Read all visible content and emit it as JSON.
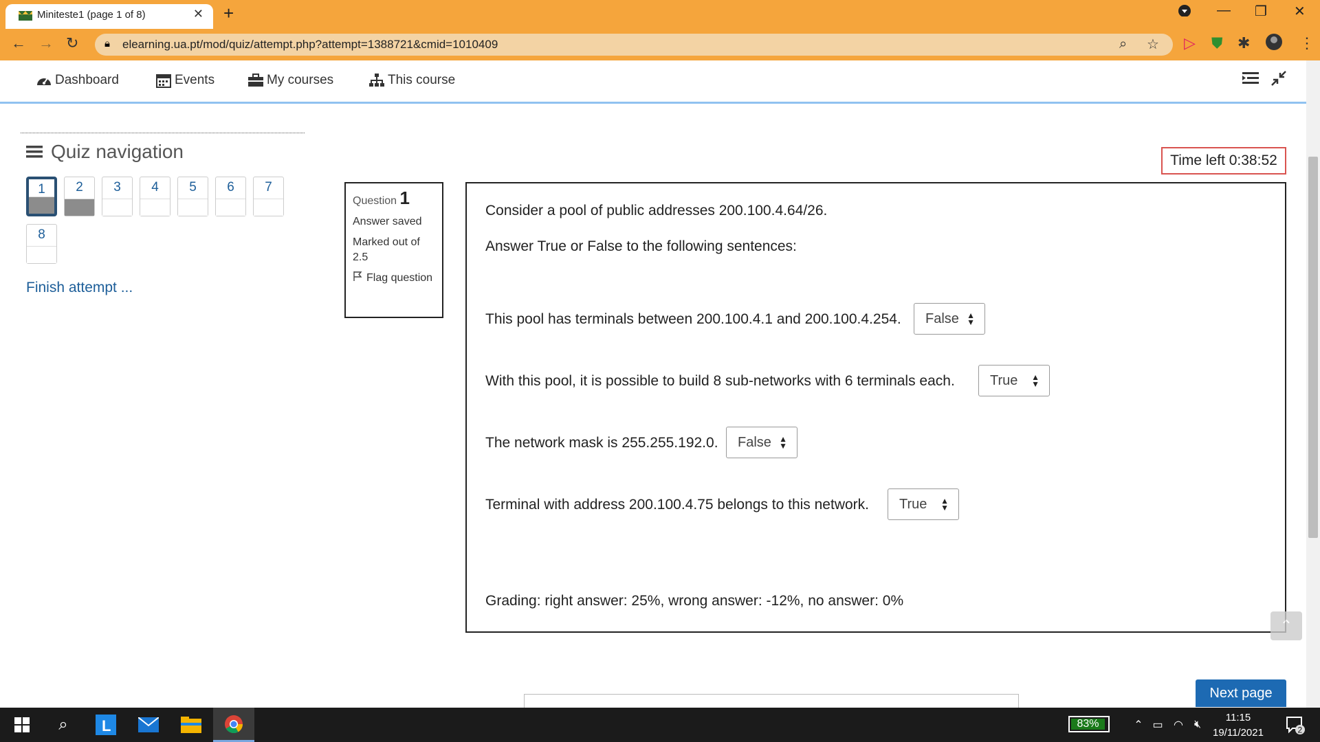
{
  "browser": {
    "tab_title": "Miniteste1 (page 1 of 8)",
    "url": "elearning.ua.pt/mod/quiz/attempt.php?attempt=1388721&cmid=1010409"
  },
  "topnav": {
    "dashboard": "Dashboard",
    "events": "Events",
    "my_courses": "My courses",
    "this_course": "This course"
  },
  "quiz_nav": {
    "title": "Quiz navigation",
    "buttons": [
      {
        "label": "1",
        "state": "answered-current"
      },
      {
        "label": "2",
        "state": "answered"
      },
      {
        "label": "3",
        "state": "unanswered"
      },
      {
        "label": "4",
        "state": "unanswered"
      },
      {
        "label": "5",
        "state": "unanswered"
      },
      {
        "label": "6",
        "state": "unanswered"
      },
      {
        "label": "7",
        "state": "unanswered"
      },
      {
        "label": "8",
        "state": "unanswered"
      }
    ],
    "finish": "Finish attempt ..."
  },
  "question_info": {
    "label": "Question",
    "number": "1",
    "status": "Answer saved",
    "marked": "Marked out of 2.5",
    "flag": "Flag question"
  },
  "timer": "Time left 0:38:52",
  "question": {
    "intro1": "Consider a pool of public addresses 200.100.4.64/26.",
    "intro2": "Answer True or False to the following sentences:",
    "items": [
      {
        "text": "This pool has terminals between 200.100.4.1 and 200.100.4.254.",
        "value": "False"
      },
      {
        "text": "With this pool, it is possible to build 8 sub-networks with 6 terminals each.",
        "value": "True"
      },
      {
        "text": "The network mask is 255.255.192.0.",
        "value": "False"
      },
      {
        "text": "Terminal with address 200.100.4.75 belongs to this network.",
        "value": "True"
      }
    ],
    "grading": "Grading: right answer: 25%, wrong answer: -12%, no answer: 0%"
  },
  "next_page": "Next page",
  "taskbar": {
    "battery": "83%",
    "time": "11:15",
    "date": "19/11/2021",
    "notifications": "2"
  }
}
